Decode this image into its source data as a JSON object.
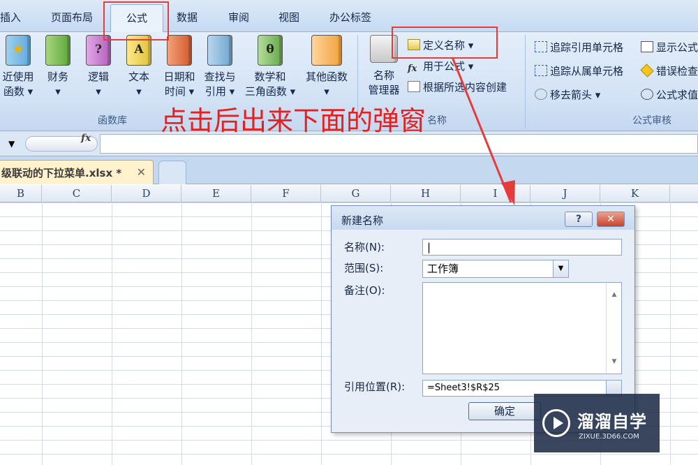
{
  "tabs": [
    {
      "label": "插入"
    },
    {
      "label": "页面布局"
    },
    {
      "label": "公式"
    },
    {
      "label": "数据"
    },
    {
      "label": "审阅"
    },
    {
      "label": "视图"
    },
    {
      "label": "办公标签"
    }
  ],
  "ribbon": {
    "function_library": {
      "group_label": "函数库",
      "buttons": [
        {
          "label1": "近使用",
          "label2": "函数 ▾",
          "icon": "recent-functions-icon"
        },
        {
          "label1": "财务",
          "label2": "▾",
          "icon": "financial-icon"
        },
        {
          "label1": "逻辑",
          "label2": "▾",
          "icon": "logical-icon"
        },
        {
          "label1": "文本",
          "label2": "▾",
          "icon": "text-icon"
        },
        {
          "label1": "日期和",
          "label2": "时间 ▾",
          "icon": "datetime-icon"
        },
        {
          "label1": "查找与",
          "label2": "引用 ▾",
          "icon": "lookup-icon"
        },
        {
          "label1": "数学和",
          "label2": "三角函数 ▾",
          "icon": "math-icon"
        },
        {
          "label1": "其他函数",
          "label2": "▾",
          "icon": "more-functions-icon"
        }
      ],
      "icon_glyphs": {
        "logical": "?",
        "text": "A",
        "math": "θ"
      }
    },
    "defined_names": {
      "group_label": "名称",
      "name_manager_line1": "名称",
      "name_manager_line2": "管理器",
      "define_name": "定义名称 ▾",
      "use_in_formula": "用于公式 ▾",
      "create_from_selection": "根据所选内容创建"
    },
    "formula_auditing": {
      "group_label": "公式审核",
      "trace_precedents": "追踪引用单元格",
      "trace_dependents": "追踪从属单元格",
      "remove_arrows": "移去箭头 ▾",
      "show_formulas": "显示公式",
      "error_checking": "错误检查",
      "evaluate_formula": "公式求值"
    }
  },
  "formula_bar": {
    "fx": "fx",
    "namebox_arrow": "▼"
  },
  "document_tab": {
    "title": "级联动的下拉菜单.xlsx *",
    "close": "✕"
  },
  "columns": [
    "B",
    "C",
    "D",
    "E",
    "F",
    "G",
    "H",
    "I",
    "J",
    "K"
  ],
  "dialog": {
    "title": "新建名称",
    "help": "?",
    "close": "✕",
    "name_label": "名称(N):",
    "name_value": "|",
    "scope_label": "范围(S):",
    "scope_value": "工作簿",
    "comment_label": "备注(O):",
    "comment_value": "",
    "refers_to_label": "引用位置(R):",
    "refers_to_value": "=Sheet3!$R$25",
    "ok_label": "确定"
  },
  "annotation": {
    "text": "点击后出来下面的弹窗",
    "color": "#e32121"
  },
  "watermark": {
    "title": "溜溜自学",
    "subtitle": "ZIXUE.3D66.COM"
  }
}
